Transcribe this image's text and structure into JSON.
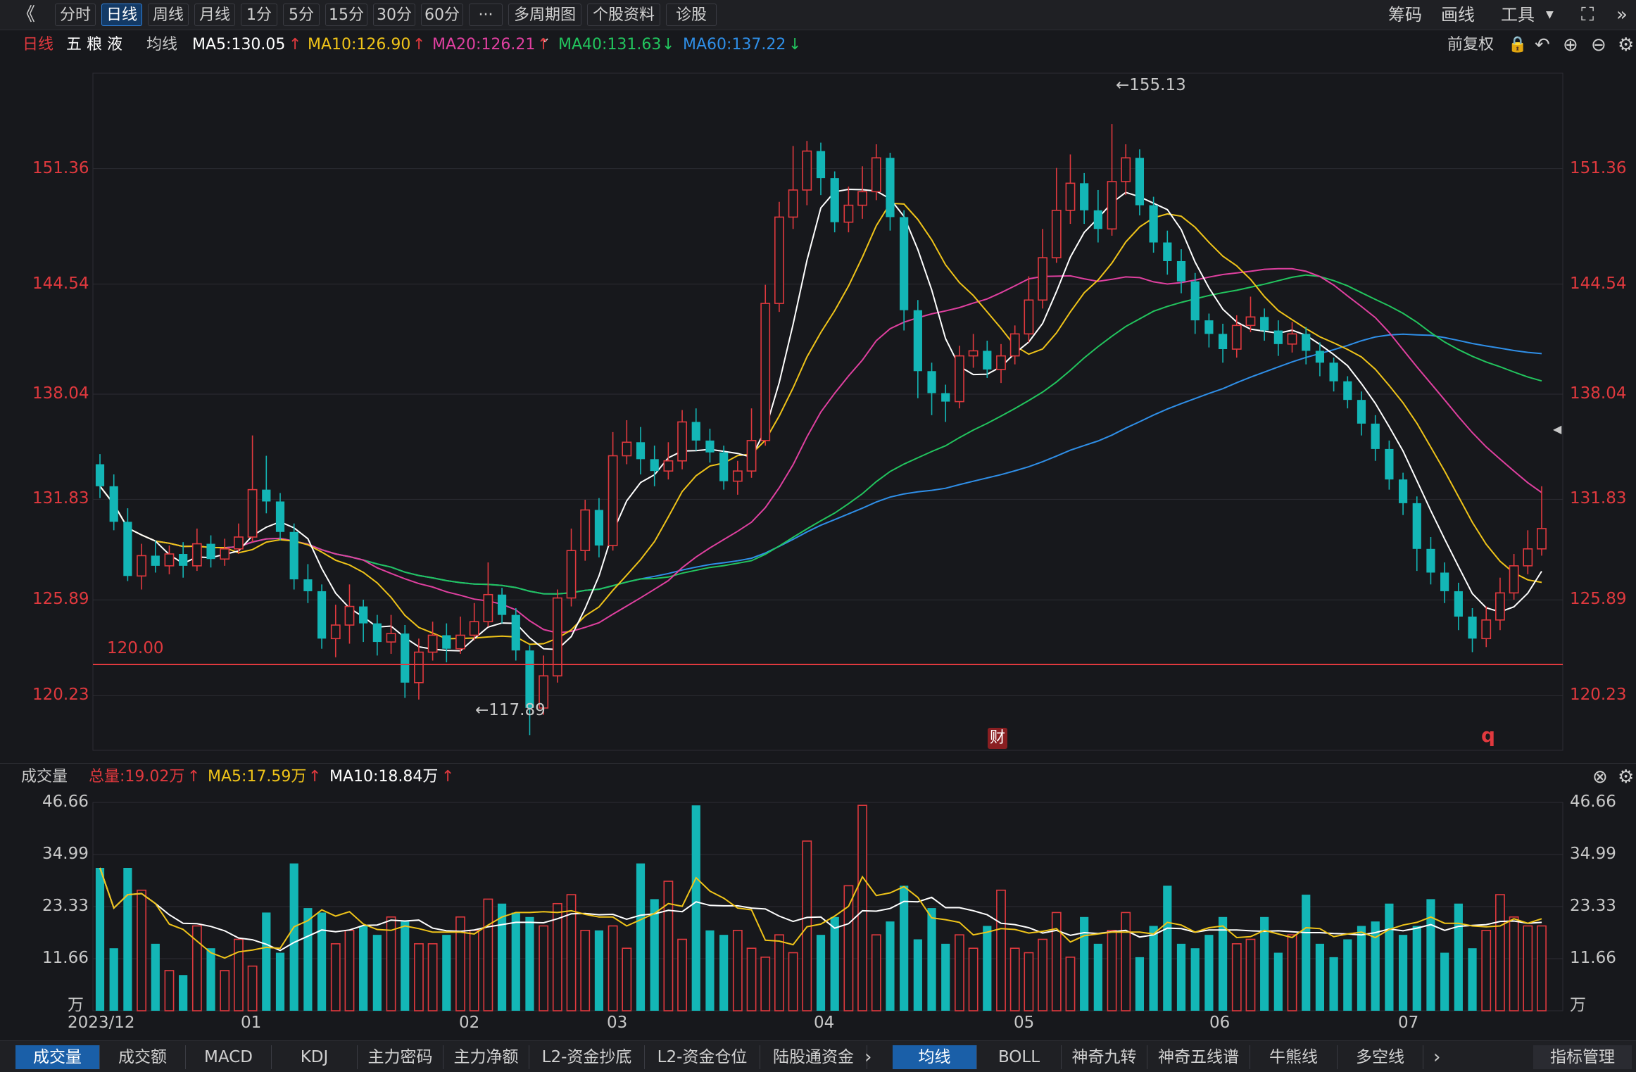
{
  "toolbar": {
    "collapse": "《",
    "periods": [
      "分时",
      "日线",
      "周线",
      "月线",
      "1分",
      "5分",
      "15分",
      "30分",
      "60分",
      "···",
      "多周期图",
      "个股资料",
      "诊股"
    ],
    "active_period": "日线",
    "right": [
      "筹码",
      "画线",
      "工具"
    ]
  },
  "info": {
    "period": "日线",
    "stock": "五 粮 液",
    "ma_label": "均线",
    "ma5": "MA5:130.05",
    "ma10": "MA10:126.90",
    "ma20": "MA20:126.21",
    "ma40": "MA40:131.63",
    "ma60": "MA60:137.22",
    "fuquan": "前复权"
  },
  "price_axis": [
    "151.36",
    "144.54",
    "138.04",
    "131.83",
    "125.89",
    "120.23"
  ],
  "annotations": {
    "high": "←155.13",
    "low": "←117.89",
    "ref_line": "120.00",
    "cai": "财",
    "q": "q"
  },
  "volume_header": {
    "label": "成交量",
    "total": "总量:19.02万",
    "ma5": "MA5:17.59万",
    "ma10": "MA10:18.84万"
  },
  "volume_axis": [
    "46.66",
    "34.99",
    "23.33",
    "11.66",
    "万"
  ],
  "x_axis": [
    "2023/12",
    "01",
    "02",
    "03",
    "04",
    "05",
    "06",
    "07"
  ],
  "bottom_tabs_left": [
    "成交量",
    "成交额",
    "MACD",
    "KDJ",
    "主力密码",
    "主力净额",
    "L2-资金抄底",
    "L2-资金仓位",
    "陆股通资金"
  ],
  "bottom_tabs_right": [
    "均线",
    "BOLL",
    "神奇九转",
    "神奇五线谱",
    "牛熊线",
    "多空线"
  ],
  "indicator_manage": "指标管理",
  "colors": {
    "up": "#e0393e",
    "down": "#13b6b6",
    "ma5": "#ffffff",
    "ma10": "#f0c419",
    "ma20": "#e040a0",
    "ma40": "#22c55e",
    "ma60": "#2f8fe8",
    "bg": "#17181c"
  },
  "chart_data": {
    "type": "candlestick",
    "ylim": [
      117.0,
      157.0
    ],
    "volume_ylim": [
      0,
      46.66
    ],
    "candles": [
      [
        133.9,
        132.6,
        134.5,
        131.9
      ],
      [
        132.6,
        130.5,
        133.3,
        130.0
      ],
      [
        130.5,
        127.3,
        131.3,
        127.0
      ],
      [
        127.3,
        128.5,
        129.2,
        126.5
      ],
      [
        128.5,
        127.9,
        129.4,
        127.5
      ],
      [
        127.9,
        128.6,
        129.1,
        127.4
      ],
      [
        128.6,
        127.9,
        129.3,
        127.2
      ],
      [
        127.9,
        129.2,
        130.1,
        127.6
      ],
      [
        129.2,
        128.3,
        129.7,
        127.8
      ],
      [
        128.3,
        128.9,
        129.5,
        127.9
      ],
      [
        128.9,
        129.6,
        130.4,
        128.6
      ],
      [
        129.6,
        132.4,
        135.6,
        129.3
      ],
      [
        132.4,
        131.7,
        134.4,
        131.0
      ],
      [
        131.7,
        129.9,
        132.2,
        129.4
      ],
      [
        129.9,
        127.1,
        130.4,
        126.5
      ],
      [
        127.1,
        126.4,
        128.0,
        125.7
      ],
      [
        126.4,
        123.6,
        126.8,
        123.0
      ],
      [
        123.6,
        124.4,
        125.6,
        122.5
      ],
      [
        124.4,
        125.5,
        126.8,
        123.3
      ],
      [
        125.5,
        124.5,
        125.9,
        123.4
      ],
      [
        124.5,
        123.4,
        125.0,
        122.6
      ],
      [
        123.4,
        123.9,
        125.0,
        122.7
      ],
      [
        123.9,
        121.0,
        124.4,
        120.1
      ],
      [
        121.0,
        122.8,
        123.6,
        120.0
      ],
      [
        122.8,
        123.8,
        124.6,
        122.3
      ],
      [
        123.8,
        123.0,
        124.5,
        122.2
      ],
      [
        123.0,
        123.8,
        124.9,
        122.7
      ],
      [
        123.8,
        124.6,
        125.7,
        123.5
      ],
      [
        124.6,
        126.2,
        128.1,
        124.3
      ],
      [
        126.2,
        125.0,
        126.6,
        124.5
      ],
      [
        125.0,
        122.9,
        125.4,
        122.3
      ],
      [
        122.9,
        119.5,
        123.2,
        117.9
      ],
      [
        119.5,
        121.4,
        122.6,
        119.1
      ],
      [
        121.4,
        126.0,
        126.5,
        121.0
      ],
      [
        126.0,
        128.8,
        130.1,
        125.5
      ],
      [
        128.8,
        131.2,
        131.8,
        128.2
      ],
      [
        131.2,
        129.1,
        131.9,
        128.4
      ],
      [
        129.1,
        134.4,
        135.8,
        128.8
      ],
      [
        134.4,
        135.2,
        136.5,
        133.9
      ],
      [
        135.2,
        134.2,
        136.1,
        133.3
      ],
      [
        134.2,
        133.5,
        135.0,
        132.6
      ],
      [
        133.5,
        134.1,
        135.2,
        133.0
      ],
      [
        134.1,
        136.4,
        137.1,
        133.6
      ],
      [
        136.4,
        135.3,
        137.2,
        134.7
      ],
      [
        135.3,
        134.6,
        136.0,
        134.0
      ],
      [
        134.6,
        132.9,
        135.0,
        132.4
      ],
      [
        132.9,
        133.5,
        134.1,
        132.1
      ],
      [
        133.5,
        135.3,
        137.2,
        133.1
      ],
      [
        135.3,
        143.4,
        144.5,
        135.0
      ],
      [
        143.4,
        148.5,
        149.4,
        142.9
      ],
      [
        148.5,
        150.1,
        152.7,
        147.8
      ],
      [
        150.1,
        152.4,
        153.0,
        149.2
      ],
      [
        152.4,
        150.8,
        152.9,
        149.8
      ],
      [
        150.8,
        148.2,
        151.2,
        147.6
      ],
      [
        148.2,
        149.2,
        150.3,
        147.6
      ],
      [
        149.2,
        150.0,
        151.5,
        148.4
      ],
      [
        150.0,
        152.0,
        152.8,
        149.5
      ],
      [
        152.0,
        148.5,
        152.3,
        147.7
      ],
      [
        148.5,
        143.0,
        148.9,
        141.8
      ],
      [
        143.0,
        139.4,
        143.6,
        137.8
      ],
      [
        139.4,
        138.1,
        139.9,
        136.8
      ],
      [
        138.1,
        137.6,
        138.6,
        136.4
      ],
      [
        137.6,
        140.3,
        140.9,
        137.2
      ],
      [
        140.3,
        140.6,
        141.6,
        139.6
      ],
      [
        140.6,
        139.5,
        141.2,
        139.0
      ],
      [
        139.5,
        140.3,
        141.0,
        138.7
      ],
      [
        140.3,
        141.6,
        142.1,
        139.8
      ],
      [
        141.6,
        143.6,
        145.0,
        141.1
      ],
      [
        143.6,
        146.1,
        147.8,
        143.1
      ],
      [
        146.1,
        148.9,
        151.4,
        145.8
      ],
      [
        148.9,
        150.5,
        152.2,
        148.1
      ],
      [
        150.5,
        148.9,
        151.1,
        148.1
      ],
      [
        148.9,
        147.8,
        150.1,
        147.0
      ],
      [
        147.8,
        150.6,
        154.0,
        147.4
      ],
      [
        150.6,
        152.0,
        152.8,
        149.8
      ],
      [
        152.0,
        149.2,
        152.5,
        148.6
      ],
      [
        149.2,
        147.0,
        149.7,
        146.4
      ],
      [
        147.0,
        145.9,
        147.7,
        145.1
      ],
      [
        145.9,
        144.7,
        146.6,
        144.0
      ],
      [
        144.7,
        142.4,
        145.2,
        141.6
      ],
      [
        142.4,
        141.6,
        142.8,
        140.8
      ],
      [
        141.6,
        140.7,
        142.2,
        139.9
      ],
      [
        140.7,
        142.1,
        142.7,
        140.2
      ],
      [
        142.1,
        142.6,
        143.8,
        141.7
      ],
      [
        142.6,
        141.8,
        143.1,
        141.2
      ],
      [
        141.8,
        141.0,
        142.4,
        140.3
      ],
      [
        141.0,
        141.6,
        142.3,
        140.5
      ],
      [
        141.6,
        140.6,
        142.0,
        139.8
      ],
      [
        140.6,
        139.9,
        141.1,
        139.1
      ],
      [
        139.9,
        138.8,
        140.2,
        138.2
      ],
      [
        138.8,
        137.7,
        139.1,
        137.2
      ],
      [
        137.7,
        136.3,
        138.2,
        135.6
      ],
      [
        136.3,
        134.8,
        136.8,
        134.1
      ],
      [
        134.8,
        133.0,
        135.3,
        132.4
      ],
      [
        133.0,
        131.6,
        133.4,
        130.9
      ],
      [
        131.6,
        128.9,
        132.0,
        127.6
      ],
      [
        128.9,
        127.5,
        129.6,
        126.8
      ],
      [
        127.5,
        126.4,
        128.1,
        125.7
      ],
      [
        126.4,
        124.9,
        126.9,
        124.1
      ],
      [
        124.9,
        123.6,
        125.4,
        122.8
      ],
      [
        123.6,
        124.7,
        125.5,
        123.1
      ],
      [
        124.7,
        126.3,
        127.2,
        124.1
      ],
      [
        126.3,
        127.9,
        128.6,
        125.9
      ],
      [
        127.9,
        128.9,
        130.0,
        127.4
      ],
      [
        128.9,
        130.1,
        132.6,
        128.5
      ]
    ],
    "volumes": [
      32.0,
      14.0,
      32.0,
      27.0,
      15.0,
      9.0,
      8.0,
      19.0,
      14.0,
      9.0,
      16.0,
      10.0,
      22.0,
      13.0,
      33.0,
      23.0,
      22.0,
      15.0,
      18.0,
      19.0,
      17.0,
      21.0,
      20.0,
      15.0,
      15.0,
      17.0,
      21.0,
      18.0,
      25.0,
      24.0,
      22.0,
      21.0,
      19.0,
      24.0,
      26.0,
      18.0,
      18.0,
      19.0,
      14.0,
      33.0,
      25.0,
      29.0,
      16.0,
      46.0,
      18.0,
      17.0,
      18.0,
      14.0,
      12.0,
      17.0,
      13.0,
      38.0,
      17.0,
      21.0,
      28.0,
      46.0,
      17.0,
      20.0,
      28.0,
      16.0,
      23.0,
      15.0,
      17.0,
      14.0,
      19.0,
      27.0,
      14.0,
      13.0,
      16.0,
      22.0,
      12.0,
      21.0,
      15.0,
      18.0,
      22.0,
      12.0,
      19.0,
      28.0,
      15.0,
      14.0,
      17.0,
      21.0,
      15.0,
      16.0,
      21.0,
      13.0,
      17.0,
      26.0,
      15.0,
      12.0,
      16.0,
      19.0,
      20.0,
      24.0,
      17.0,
      19.0,
      25.0,
      13.0,
      24.0,
      14.0,
      18.0,
      26.0,
      21.0,
      19.0,
      19.0
    ]
  }
}
